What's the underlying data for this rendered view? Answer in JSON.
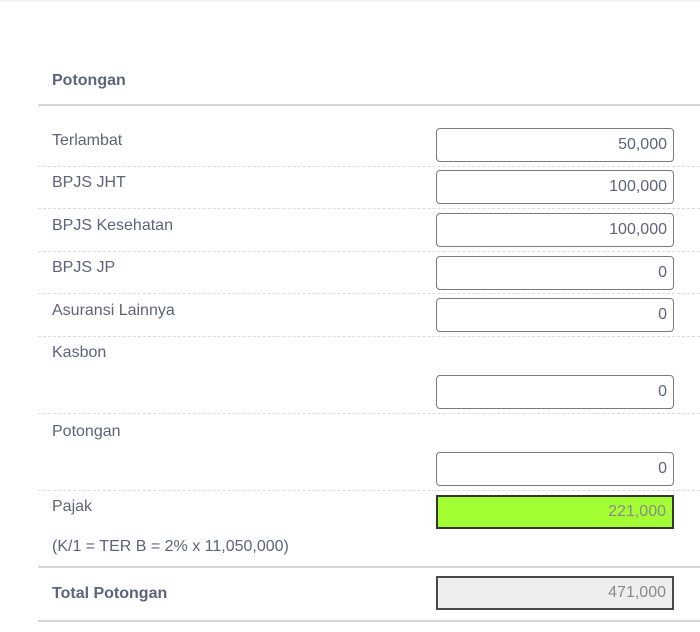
{
  "section": {
    "title": "Potongan"
  },
  "rows": [
    {
      "label": "Terlambat",
      "value": "50,000"
    },
    {
      "label": "BPJS JHT",
      "value": "100,000"
    },
    {
      "label": "BPJS Kesehatan",
      "value": "100,000"
    },
    {
      "label": "BPJS JP",
      "value": "0"
    },
    {
      "label": "Asuransi Lainnya",
      "value": "0"
    },
    {
      "label": "Kasbon",
      "value": "0"
    },
    {
      "label": "Potongan",
      "value": "0"
    },
    {
      "label": "Pajak",
      "value": "221,000",
      "note": "(K/1 = TER B = 2% x 11,050,000)",
      "highlight_color": "#a3ff33"
    }
  ],
  "total": {
    "label": "Total Potongan",
    "value": "471,000"
  }
}
